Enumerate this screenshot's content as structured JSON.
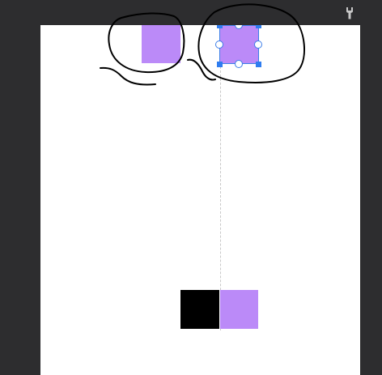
{
  "toolbar": {
    "tool_icon": "wrench-icon",
    "tool_icon_color": "#c8c8c8"
  },
  "canvas": {
    "background": "#ffffff",
    "shapes": [
      {
        "name": "purple-square-top-left",
        "color": "#bb8af8"
      },
      {
        "name": "purple-square-top-selected",
        "color": "#bb8af8",
        "selected": true
      },
      {
        "name": "black-square-bottom",
        "color": "#000000"
      },
      {
        "name": "purple-square-bottom",
        "color": "#bb8af8"
      }
    ],
    "selection_color": "#3c7ee8",
    "guide_color": "#c8c8c8"
  },
  "annotations": {
    "ink_color": "#000000",
    "strokes": [
      "circle-around-left-square",
      "circle-around-selected-square",
      "connector-scribble"
    ]
  }
}
